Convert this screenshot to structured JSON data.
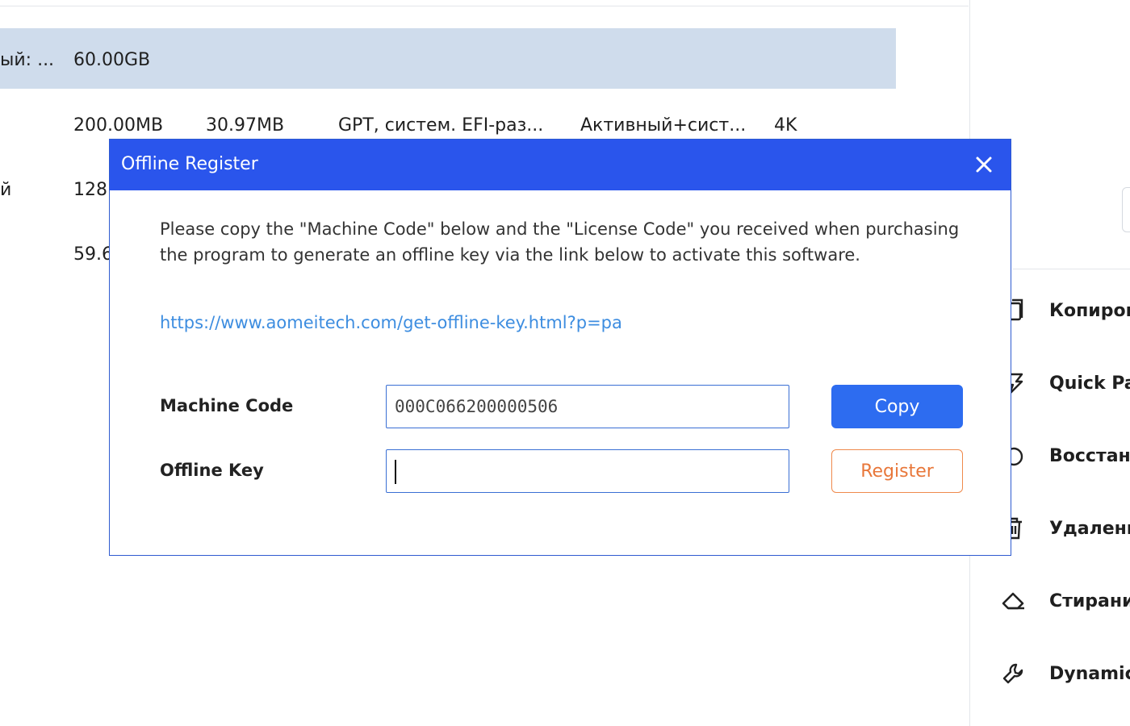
{
  "table": {
    "rows": [
      {
        "col1": "ый: ...",
        "size": "60.00GB",
        "used": "",
        "fs": "",
        "status": "",
        "align": "",
        "selected": true
      },
      {
        "col1": "",
        "size": "200.00MB",
        "used": "30.97MB",
        "fs": "GPT, систем. EFI-раз...",
        "status": "Активный+сист...",
        "align": "4K",
        "selected": false
      },
      {
        "col1": "й",
        "size": "128.",
        "used": "",
        "fs": "",
        "status": "",
        "align": "",
        "selected": false
      },
      {
        "col1": "",
        "size": "59.6",
        "used": "",
        "fs": "",
        "status": "",
        "align": "",
        "selected": false
      }
    ]
  },
  "sidebar": {
    "items": [
      {
        "label": "Копиров",
        "icon": "copy-disk-icon"
      },
      {
        "label": "Quick Pa",
        "icon": "quick-partition-icon"
      },
      {
        "label": "Восстан",
        "icon": "recover-icon"
      },
      {
        "label": "Удалени",
        "icon": "trash-icon"
      },
      {
        "label": "Стирани",
        "icon": "eraser-icon"
      },
      {
        "label": "Dynamic",
        "icon": "wrench-icon"
      }
    ]
  },
  "dialog": {
    "title": "Offline Register",
    "message": "Please copy the \"Machine Code\" below and the \"License Code\" you received when purchasing the program to generate an offline key via the link below to activate this software.",
    "link": "https://www.aomeitech.com/get-offline-key.html?p=pa",
    "machine_code_label": "Machine Code",
    "machine_code_value": "000C066200000506",
    "offline_key_label": "Offline Key",
    "offline_key_value": "",
    "copy_label": "Copy",
    "register_label": "Register"
  },
  "colors": {
    "titlebar": "#2a55ec",
    "copy_button": "#2d6cf0",
    "register_text": "#e8773a",
    "link": "#3d8de0",
    "selected_row": "#cfdcec"
  }
}
